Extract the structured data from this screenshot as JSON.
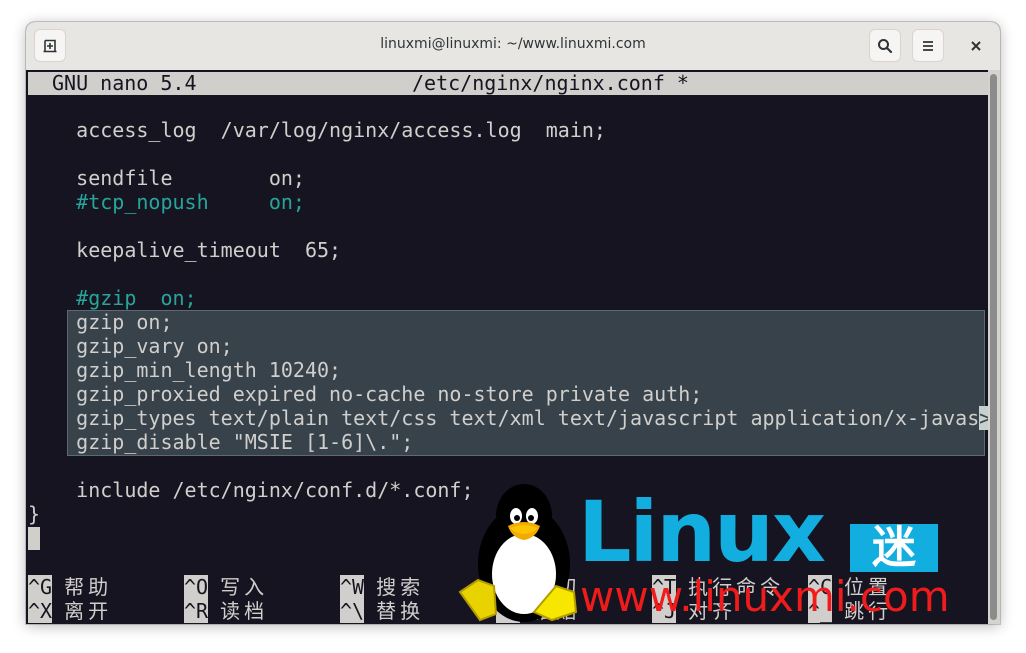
{
  "window": {
    "title": "linuxmi@linuxmi: ~/www.linuxmi.com",
    "buttons": {
      "new_tab_icon": "new-tab-icon",
      "search_icon": "search-icon",
      "menu_icon": "hamburger-menu-icon",
      "close_icon": "close-icon"
    }
  },
  "nano": {
    "version": "GNU nano 5.4",
    "filename": "/etc/nginx/nginx.conf *",
    "lines": [
      {
        "text": "",
        "type": "normal"
      },
      {
        "text": "    access_log  /var/log/nginx/access.log  main;",
        "type": "normal"
      },
      {
        "text": "",
        "type": "normal"
      },
      {
        "text": "    sendfile        on;",
        "type": "normal"
      },
      {
        "text": "    #tcp_nopush     on;",
        "type": "comment"
      },
      {
        "text": "",
        "type": "normal"
      },
      {
        "text": "    keepalive_timeout  65;",
        "type": "normal"
      },
      {
        "text": "",
        "type": "normal"
      },
      {
        "text": "    #gzip  on;",
        "type": "comment"
      },
      {
        "text": "    gzip on;",
        "type": "selected"
      },
      {
        "text": "    gzip_vary on;",
        "type": "selected"
      },
      {
        "text": "    gzip_min_length 10240;",
        "type": "selected"
      },
      {
        "text": "    gzip_proxied expired no-cache no-store private auth;",
        "type": "selected"
      },
      {
        "text": "    gzip_types text/plain text/css text/xml text/javascript application/x-javas",
        "type": "selected",
        "truncated_marker": ">"
      },
      {
        "text": "    gzip_disable \"MSIE [1-6]\\.\";",
        "type": "selected"
      },
      {
        "text": "",
        "type": "normal"
      },
      {
        "text": "    include /etc/nginx/conf.d/*.conf;",
        "type": "normal"
      },
      {
        "text": "}",
        "type": "normal"
      }
    ],
    "shortcuts": [
      [
        {
          "key": "^G",
          "label": "帮助"
        },
        {
          "key": "^O",
          "label": "写入"
        },
        {
          "key": "^W",
          "label": "搜索"
        },
        {
          "key": "^K",
          "label": "剪切"
        },
        {
          "key": "^T",
          "label": "执行命令"
        },
        {
          "key": "^C",
          "label": "位置"
        }
      ],
      [
        {
          "key": "^X",
          "label": "离开"
        },
        {
          "key": "^R",
          "label": "读档"
        },
        {
          "key": "^\\",
          "label": "替换"
        },
        {
          "key": "^U",
          "label": "粘贴"
        },
        {
          "key": "^J",
          "label": "对齐"
        },
        {
          "key": "^_",
          "label": "跳行"
        }
      ]
    ]
  },
  "watermark": {
    "logo_text": "Linux",
    "logo_char": "迷",
    "url": "www.linuxmi.com"
  },
  "colors": {
    "terminal_bg": "#171421",
    "terminal_fg": "#d0cfcc",
    "comment": "#26a69a",
    "selection_bg": "#37424b",
    "logo_blue": "#13aee0",
    "logo_red": "#f01c1c"
  }
}
